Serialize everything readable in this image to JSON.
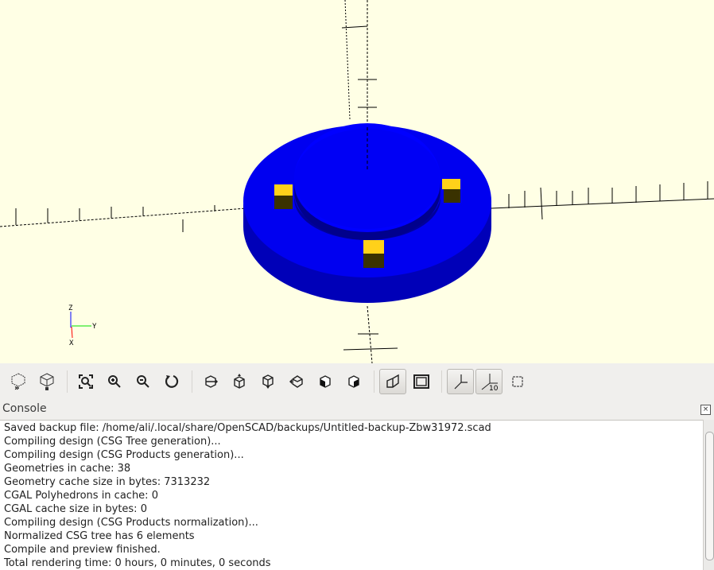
{
  "viewport": {
    "background": "#ffffe5",
    "model_color": "#0000ff",
    "marker_color": "#ffd11a",
    "axis_labels": {
      "x": "X",
      "y": "Y",
      "z": "Z"
    }
  },
  "toolbar": {
    "buttons": [
      {
        "name": "preview",
        "icon": "preview-icon"
      },
      {
        "name": "render",
        "icon": "render-icon"
      },
      {
        "name": "view-all",
        "icon": "zoom-fit-icon"
      },
      {
        "name": "zoom-in",
        "icon": "zoom-in-icon"
      },
      {
        "name": "zoom-out",
        "icon": "zoom-out-icon"
      },
      {
        "name": "reset-view",
        "icon": "reset-view-icon"
      },
      {
        "name": "view-right",
        "icon": "view-right-icon"
      },
      {
        "name": "view-top",
        "icon": "view-top-icon"
      },
      {
        "name": "view-bottom",
        "icon": "view-bottom-icon"
      },
      {
        "name": "view-left",
        "icon": "view-left-icon"
      },
      {
        "name": "view-front",
        "icon": "view-front-icon"
      },
      {
        "name": "view-back",
        "icon": "view-back-icon"
      },
      {
        "name": "perspective",
        "icon": "perspective-icon",
        "active": true
      },
      {
        "name": "orthogonal",
        "icon": "orthogonal-icon"
      },
      {
        "name": "show-axes",
        "icon": "axes-icon",
        "active": true
      },
      {
        "name": "show-scale-markers",
        "icon": "scale-markers-icon",
        "active": true,
        "label": "10"
      },
      {
        "name": "show-edges",
        "icon": "edges-icon"
      }
    ]
  },
  "console": {
    "title": "Console",
    "lines": [
      "Saved backup file: /home/ali/.local/share/OpenSCAD/backups/Untitled-backup-Zbw31972.scad",
      "Compiling design (CSG Tree generation)...",
      "Compiling design (CSG Products generation)...",
      "Geometries in cache: 38",
      "Geometry cache size in bytes: 7313232",
      "CGAL Polyhedrons in cache: 0",
      "CGAL cache size in bytes: 0",
      "Compiling design (CSG Products normalization)...",
      "Normalized CSG tree has 6 elements",
      "Compile and preview finished.",
      "Total rendering time: 0 hours, 0 minutes, 0 seconds"
    ]
  }
}
